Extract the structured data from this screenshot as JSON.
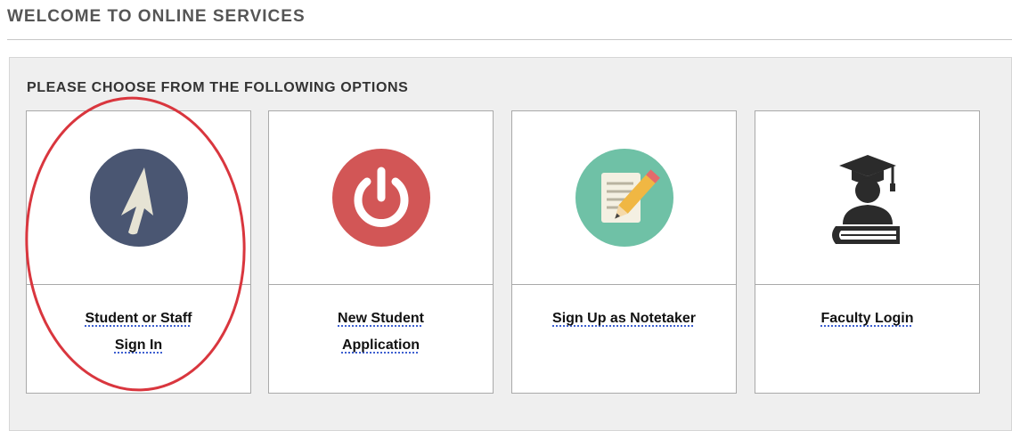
{
  "page": {
    "title": "WELCOME TO ONLINE SERVICES"
  },
  "panel": {
    "heading": "PLEASE CHOOSE FROM THE FOLLOWING OPTIONS"
  },
  "options": [
    {
      "label_line1": "Student or Staff",
      "label_line2": "Sign In",
      "icon": "cursor-icon",
      "icon_color": "#4a5672"
    },
    {
      "label_line1": "New Student",
      "label_line2": "Application",
      "icon": "power-icon",
      "icon_color": "#d25656"
    },
    {
      "label_line1": "Sign Up as Notetaker",
      "label_line2": "",
      "icon": "notepad-pencil-icon",
      "icon_color": "#6fc1a6"
    },
    {
      "label_line1": "Faculty Login",
      "label_line2": "",
      "icon": "graduate-book-icon",
      "icon_color": "#2b2b2b"
    }
  ],
  "annotation": {
    "highlight_color": "#d9363e"
  }
}
